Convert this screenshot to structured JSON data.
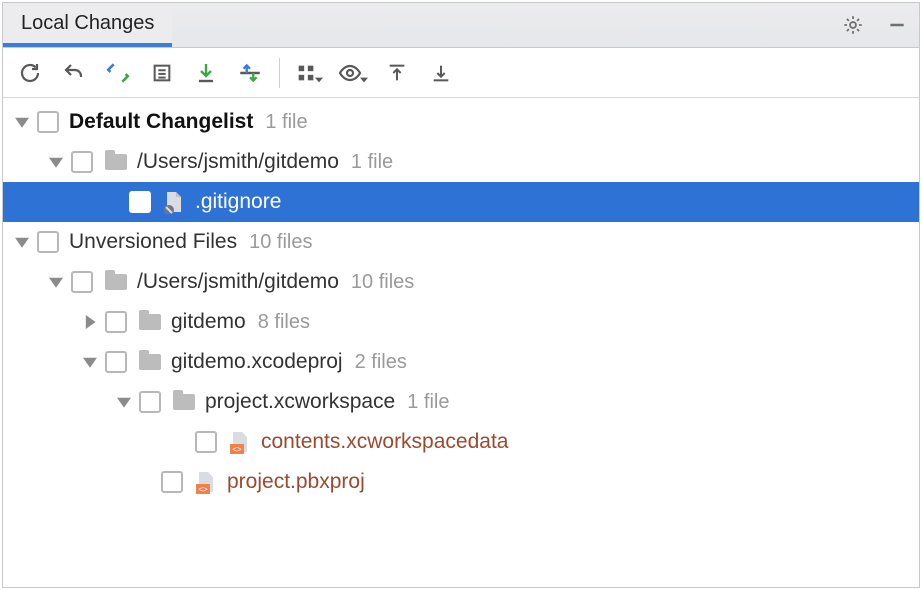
{
  "tabs": {
    "active": "Local Changes"
  },
  "toolbar_icons": [
    "refresh",
    "rollback",
    "sync",
    "list",
    "commit",
    "shelve",
    "group",
    "preview",
    "expand",
    "collapse"
  ],
  "tree": {
    "changelist": {
      "label": "Default Changelist",
      "count": "1 file",
      "path": {
        "label": "/Users/jsmith/gitdemo",
        "count": "1 file"
      },
      "file": {
        "label": ".gitignore"
      }
    },
    "unversioned": {
      "label": "Unversioned Files",
      "count": "10 files",
      "path": {
        "label": "/Users/jsmith/gitdemo",
        "count": "10 files"
      },
      "sub1": {
        "label": "gitdemo",
        "count": "8 files"
      },
      "sub2": {
        "label": "gitdemo.xcodeproj",
        "count": "2 files"
      },
      "workspace": {
        "label": "project.xcworkspace",
        "count": "1 file"
      },
      "file1": {
        "label": "contents.xcworkspacedata"
      },
      "file2": {
        "label": "project.pbxproj"
      }
    }
  }
}
